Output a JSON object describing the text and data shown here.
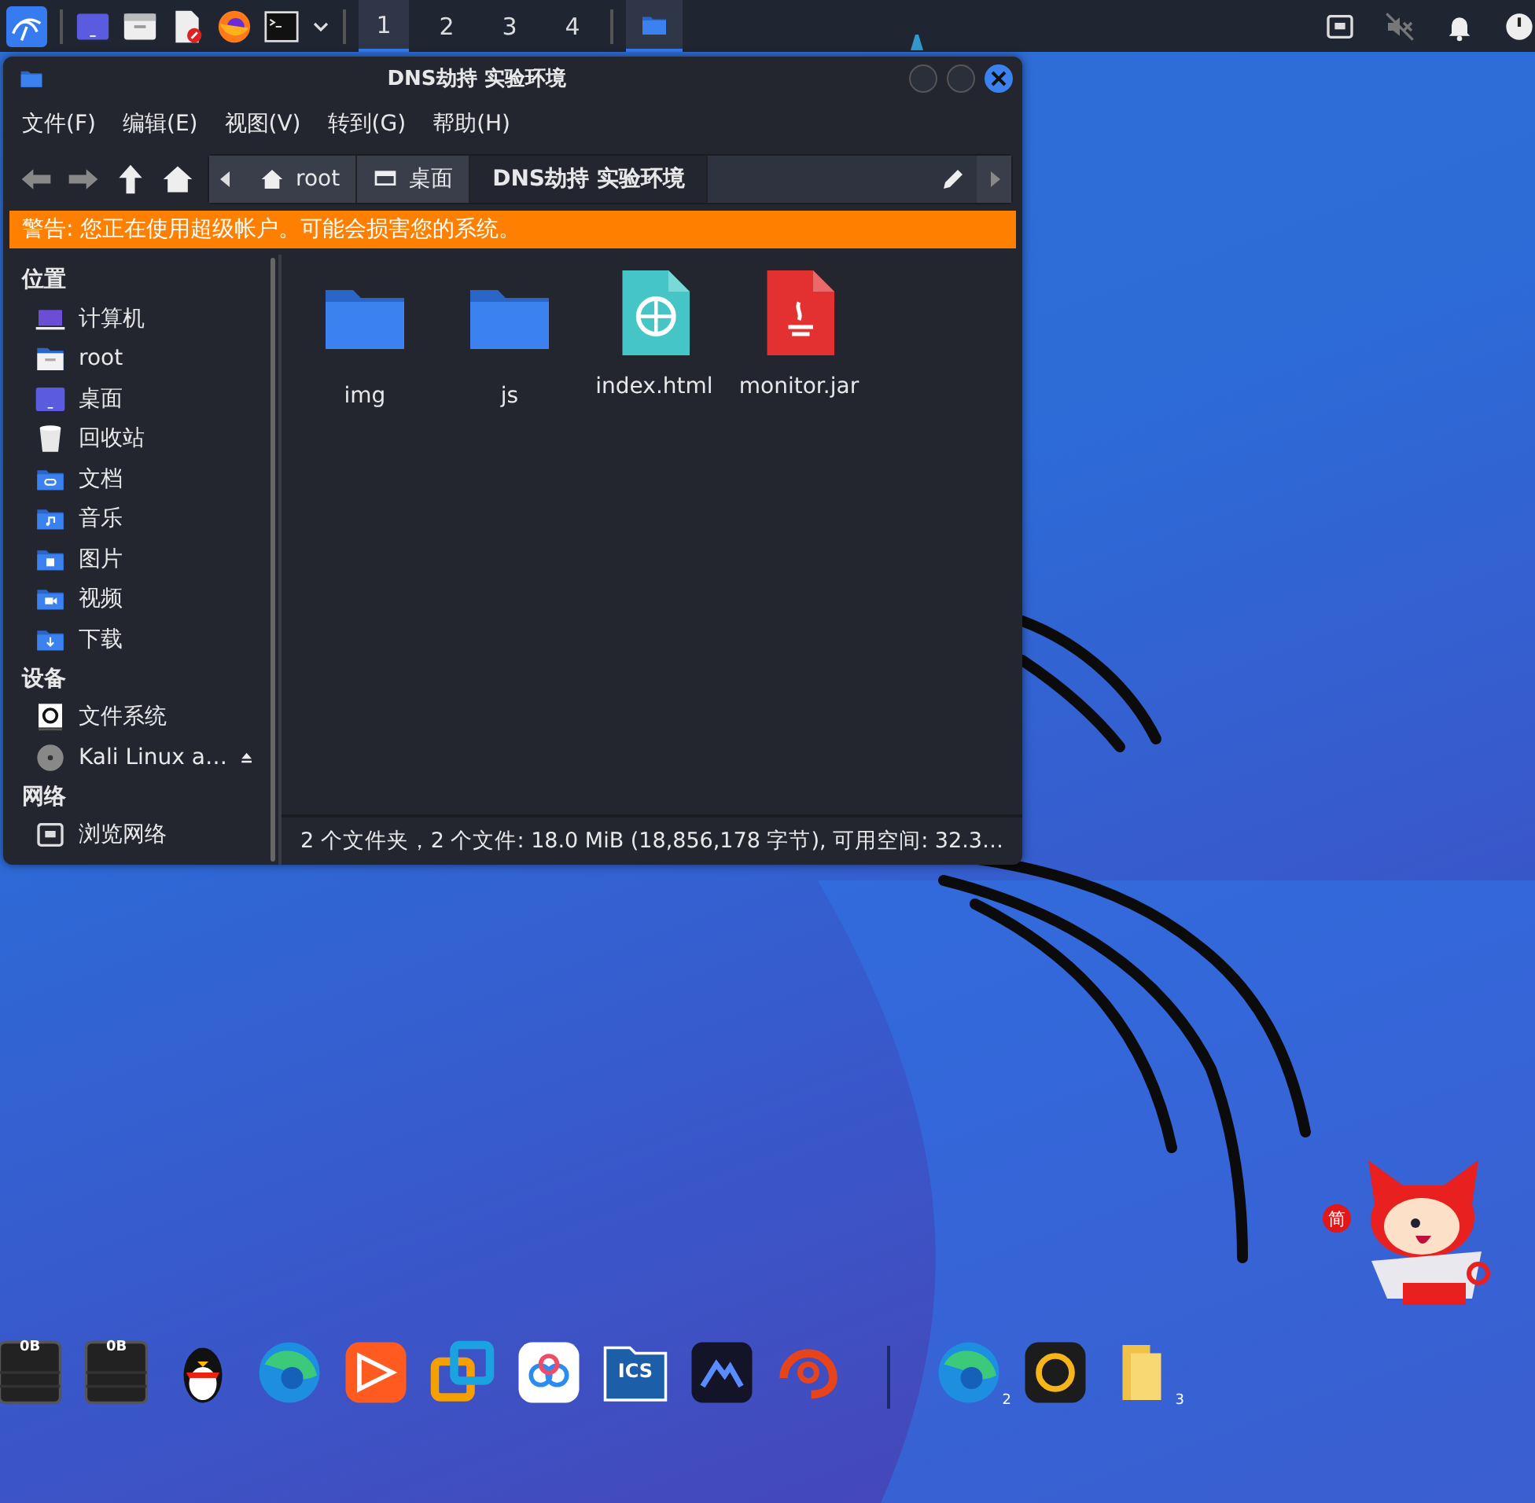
{
  "top_panel": {
    "launchers": [
      {
        "kind": "kali"
      },
      {
        "kind": "desktop"
      },
      {
        "kind": "files"
      },
      {
        "kind": "editor"
      },
      {
        "kind": "firefox"
      },
      {
        "kind": "terminal"
      }
    ],
    "workspaces": [
      {
        "label": "1",
        "selected": true
      },
      {
        "label": "2",
        "selected": false
      },
      {
        "label": "3",
        "selected": false
      },
      {
        "label": "4",
        "selected": false
      }
    ],
    "tasks": [
      {
        "kind": "folder",
        "selected": true
      }
    ],
    "tray": [
      {
        "kind": "network"
      },
      {
        "kind": "muted"
      },
      {
        "kind": "bell"
      },
      {
        "kind": "power"
      }
    ]
  },
  "window": {
    "title": "DNS劫持 实验环境",
    "menu": [
      "文件(F)",
      "编辑(E)",
      "视图(V)",
      "转到(G)",
      "帮助(H)"
    ],
    "path": [
      {
        "label": "root",
        "kind": "home",
        "selected": false
      },
      {
        "label": "桌面",
        "kind": "desktop",
        "selected": false
      },
      {
        "label": "DNS劫持 实验环境",
        "kind": "none",
        "selected": true
      }
    ],
    "warning": "警告: 您正在使用超级帐户。可能会损害您的系统。",
    "sidebar": [
      {
        "heading": "位置",
        "items": [
          {
            "label": "计算机",
            "kind": "computer"
          },
          {
            "label": "root",
            "kind": "homefolder"
          },
          {
            "label": "桌面",
            "kind": "desktop"
          },
          {
            "label": "回收站",
            "kind": "trash"
          },
          {
            "label": "文档",
            "kind": "documents"
          },
          {
            "label": "音乐",
            "kind": "music"
          },
          {
            "label": "图片",
            "kind": "pictures"
          },
          {
            "label": "视频",
            "kind": "videos"
          },
          {
            "label": "下载",
            "kind": "downloads"
          }
        ]
      },
      {
        "heading": "设备",
        "items": [
          {
            "label": "文件系统",
            "kind": "drive"
          },
          {
            "label": "Kali Linux a…",
            "kind": "disc",
            "ejectable": true
          }
        ]
      },
      {
        "heading": "网络",
        "items": [
          {
            "label": "浏览网络",
            "kind": "network"
          }
        ]
      }
    ],
    "files": [
      {
        "name": "img",
        "kind": "folder"
      },
      {
        "name": "js",
        "kind": "folder"
      },
      {
        "name": "index.html",
        "kind": "html"
      },
      {
        "name": "monitor.jar",
        "kind": "jar"
      }
    ],
    "status_bar": "2 个文件夹，2 个文件: 18.0 MiB (18,856,178 字节), 可用空间: 32.3…"
  },
  "dock": [
    {
      "kind": "meter",
      "label": "0B"
    },
    {
      "kind": "meter",
      "label": "0B"
    },
    {
      "kind": "penguin"
    },
    {
      "kind": "edge"
    },
    {
      "kind": "media"
    },
    {
      "kind": "vm"
    },
    {
      "kind": "cloud"
    },
    {
      "kind": "ics",
      "label": "ICS"
    },
    {
      "kind": "mountain"
    },
    {
      "kind": "shell"
    },
    {
      "kind": "separator"
    },
    {
      "kind": "edge",
      "badge": "2"
    },
    {
      "kind": "assistant"
    },
    {
      "kind": "yellowfolder",
      "badge": "3"
    }
  ],
  "ime_widget": {
    "mode": "简"
  }
}
